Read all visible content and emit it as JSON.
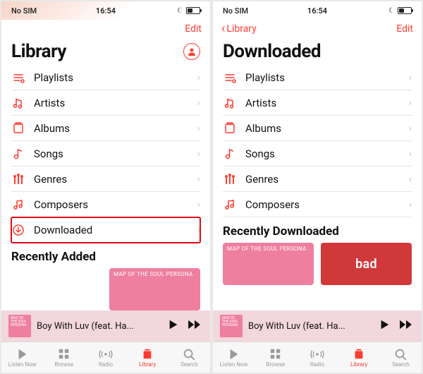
{
  "status": {
    "carrier": "No SIM",
    "time": "16:54"
  },
  "nav": {
    "back_label": "Library",
    "edit": "Edit"
  },
  "left": {
    "title": "Library",
    "rows": [
      {
        "id": "playlists",
        "label": "Playlists"
      },
      {
        "id": "artists",
        "label": "Artists"
      },
      {
        "id": "albums",
        "label": "Albums"
      },
      {
        "id": "songs",
        "label": "Songs"
      },
      {
        "id": "genres",
        "label": "Genres"
      },
      {
        "id": "composers",
        "label": "Composers"
      },
      {
        "id": "downloaded",
        "label": "Downloaded",
        "highlighted": true
      }
    ],
    "section": "Recently Added",
    "card_text": "MAP OF THE SOUL  PERSONA"
  },
  "right": {
    "title": "Downloaded",
    "rows": [
      {
        "id": "playlists",
        "label": "Playlists"
      },
      {
        "id": "artists",
        "label": "Artists"
      },
      {
        "id": "albums",
        "label": "Albums"
      },
      {
        "id": "songs",
        "label": "Songs"
      },
      {
        "id": "genres",
        "label": "Genres"
      },
      {
        "id": "composers",
        "label": "Composers"
      }
    ],
    "section": "Recently Downloaded",
    "card1_text": "MAP OF THE SOUL  PERSONA",
    "card2_text": "bad"
  },
  "now_playing": {
    "title": "Boy With Luv (feat. Ha...",
    "art_text": "MAP OF THE SOUL PERSONA"
  },
  "tabs": [
    {
      "id": "listen",
      "label": "Listen Now"
    },
    {
      "id": "browse",
      "label": "Browse"
    },
    {
      "id": "radio",
      "label": "Radio"
    },
    {
      "id": "library",
      "label": "Library"
    },
    {
      "id": "search",
      "label": "Search"
    }
  ]
}
